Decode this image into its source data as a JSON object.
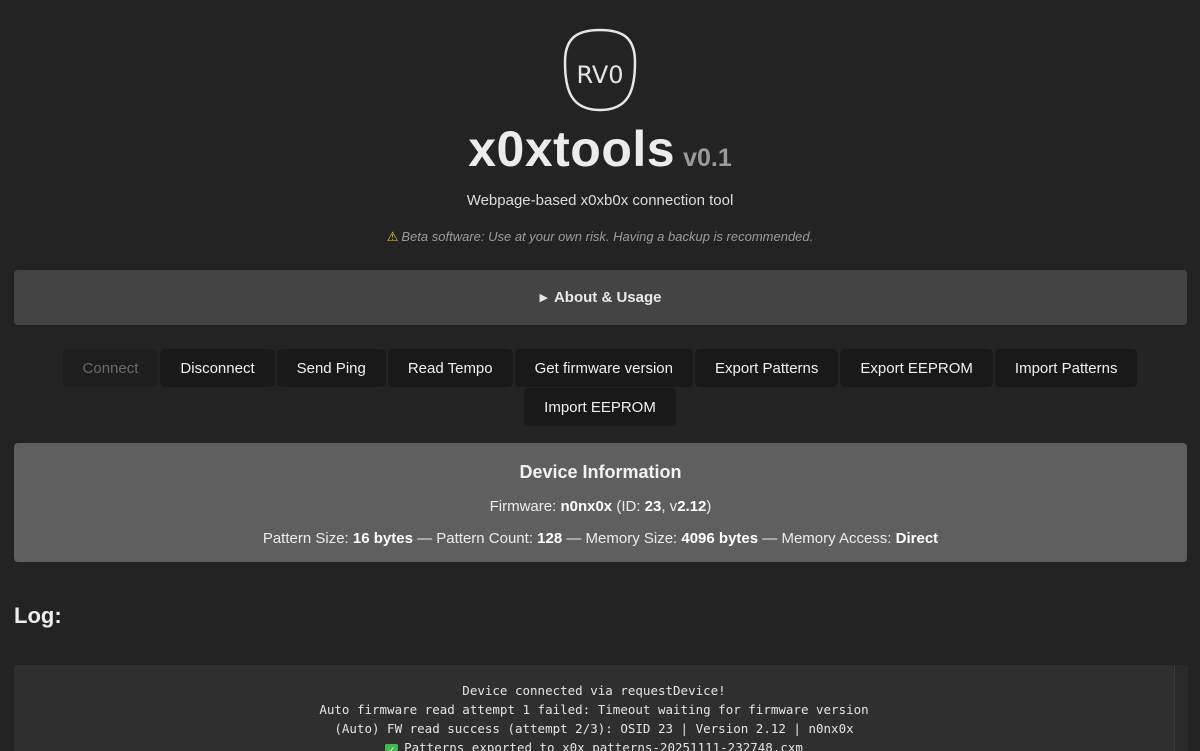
{
  "header": {
    "logo_text": "RV0",
    "title": "x0xtools",
    "version": "v0.1",
    "subtitle": "Webpage-based x0xb0x connection tool",
    "warning": "Beta software: Use at your own risk. Having a backup is recommended."
  },
  "about": {
    "label": "About & Usage"
  },
  "buttons": {
    "row1": [
      "Connect",
      "Disconnect",
      "Send Ping",
      "Read Tempo",
      "Get firmware version",
      "Export Patterns",
      "Export EEPROM",
      "Import Patterns"
    ],
    "row2": [
      "Import EEPROM"
    ]
  },
  "device": {
    "heading": "Device Information",
    "firmware_label": "Firmware: ",
    "firmware_name": "n0nx0x",
    "id_prefix": " (ID: ",
    "id_value": "23",
    "version_prefix": ", v",
    "version_value": "2.12",
    "closing": ")",
    "pattern_size_label": "Pattern Size: ",
    "pattern_size_value": "16 bytes",
    "pattern_count_label": " — Pattern Count: ",
    "pattern_count_value": "128",
    "memory_size_label": " — Memory Size: ",
    "memory_size_value": "4096 bytes",
    "memory_access_label": " — Memory Access: ",
    "memory_access_value": "Direct"
  },
  "log": {
    "title": "Log:",
    "lines": [
      "Device connected via requestDevice!",
      "Auto firmware read attempt 1 failed: Timeout waiting for firmware version",
      "(Auto) FW read success (attempt 2/3): OSID 23 | Version 2.12 | n0nx0x",
      "Patterns exported to x0x_patterns-20251111-232748.cxm"
    ]
  }
}
